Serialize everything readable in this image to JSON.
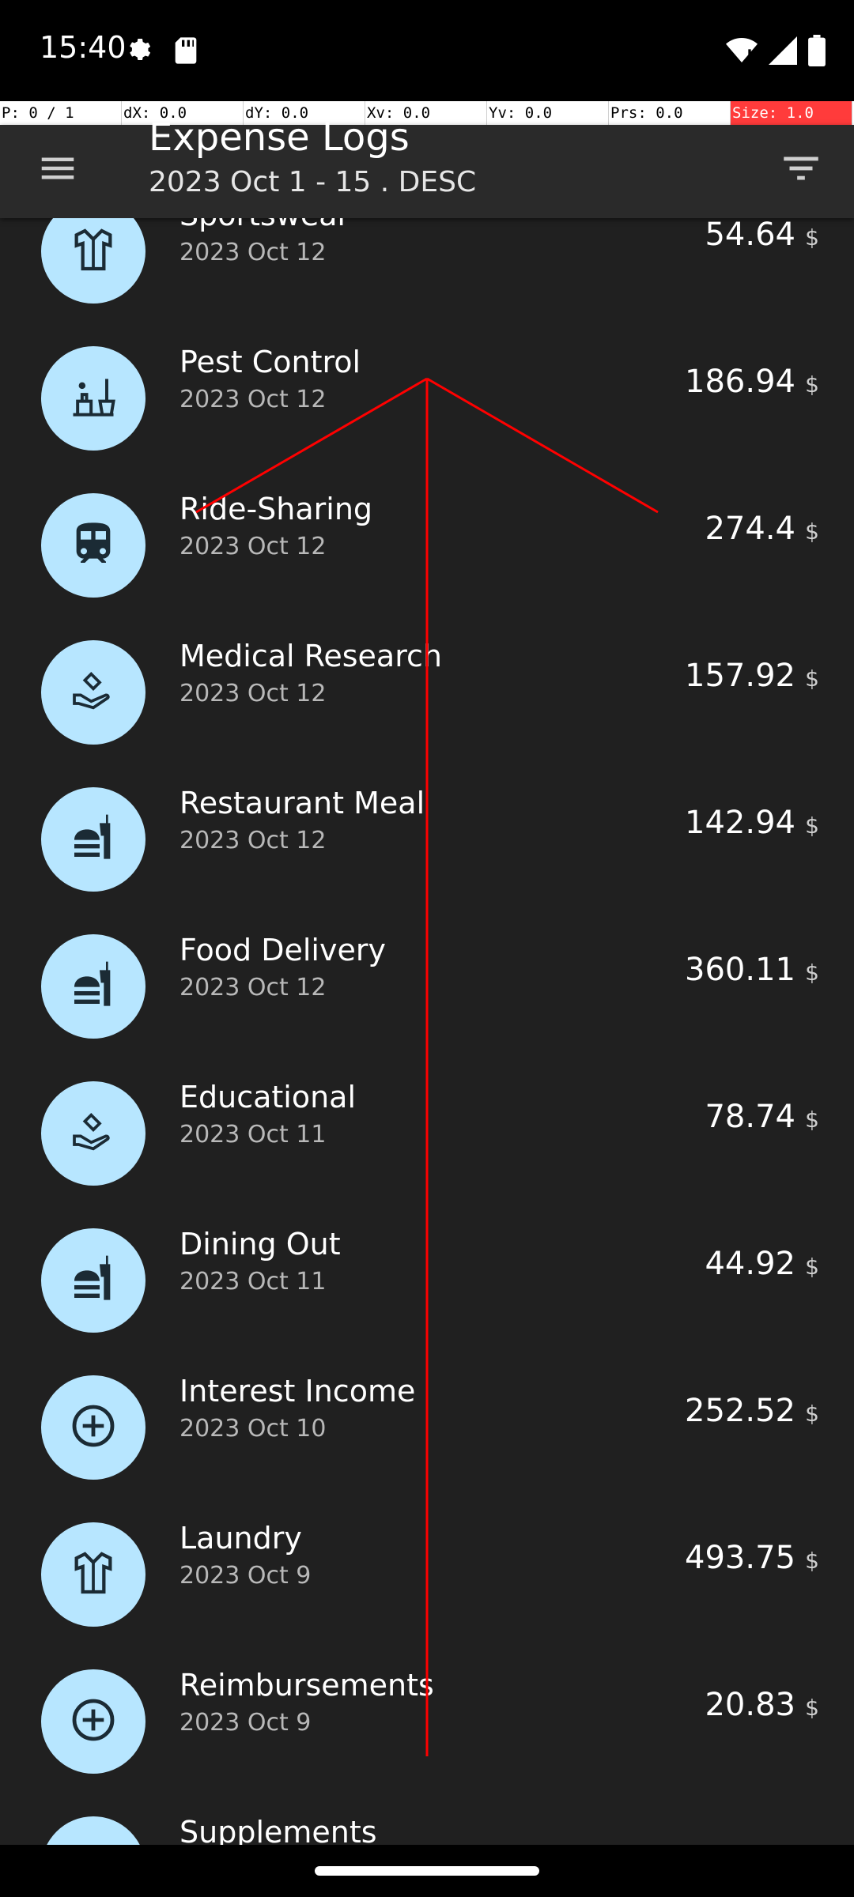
{
  "status_bar": {
    "time": "15:40"
  },
  "debug": [
    "P: 0 / 1",
    "dX: 0.0",
    "dY: 0.0",
    "Xv: 0.0",
    "Yv: 0.0",
    "Prs: 0.0",
    "Size: 1.0"
  ],
  "header": {
    "title": "Expense Logs",
    "subtitle": "2023 Oct 1 - 15 . DESC",
    "menu_icon": "hamburger-menu-icon",
    "filter_icon": "filter-icon"
  },
  "items": [
    {
      "title": "Sportswear",
      "date": "2023 Oct 12",
      "amount": "54.64",
      "currency": "$",
      "icon": "shirt-icon"
    },
    {
      "title": "Pest Control",
      "date": "2023 Oct 12",
      "amount": "186.94",
      "currency": "$",
      "icon": "cleaning-icon"
    },
    {
      "title": "Ride-Sharing",
      "date": "2023 Oct 12",
      "amount": "274.4",
      "currency": "$",
      "icon": "train-icon"
    },
    {
      "title": "Medical Research",
      "date": "2023 Oct 12",
      "amount": "157.92",
      "currency": "$",
      "icon": "hand-heart-icon"
    },
    {
      "title": "Restaurant Meal",
      "date": "2023 Oct 12",
      "amount": "142.94",
      "currency": "$",
      "icon": "fast-food-icon"
    },
    {
      "title": "Food Delivery",
      "date": "2023 Oct 12",
      "amount": "360.11",
      "currency": "$",
      "icon": "fast-food-icon"
    },
    {
      "title": "Educational",
      "date": "2023 Oct 11",
      "amount": "78.74",
      "currency": "$",
      "icon": "hand-heart-icon"
    },
    {
      "title": "Dining Out",
      "date": "2023 Oct 11",
      "amount": "44.92",
      "currency": "$",
      "icon": "fast-food-icon"
    },
    {
      "title": "Interest Income",
      "date": "2023 Oct 10",
      "amount": "252.52",
      "currency": "$",
      "icon": "add-circle-icon"
    },
    {
      "title": "Laundry",
      "date": "2023 Oct 9",
      "amount": "493.75",
      "currency": "$",
      "icon": "shirt-icon"
    },
    {
      "title": "Reimbursements",
      "date": "2023 Oct 9",
      "amount": "20.83",
      "currency": "$",
      "icon": "add-circle-icon"
    },
    {
      "title": "Supplements",
      "date": "",
      "amount": "",
      "currency": "",
      "icon": "hand-heart-icon"
    }
  ],
  "colors": {
    "accent": "#b7e6ff",
    "background": "#202020",
    "appbar": "#2a2a2a",
    "overlay_line": "#ff0000"
  }
}
